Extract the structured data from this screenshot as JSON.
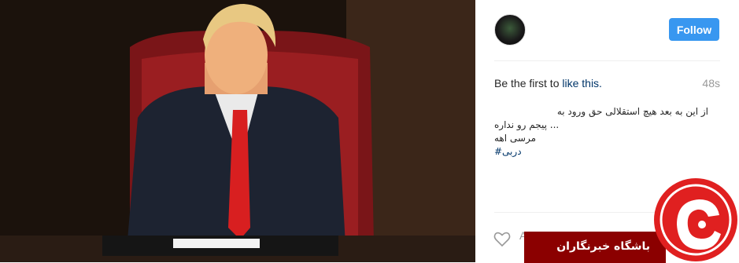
{
  "post": {
    "follow_label": "Follow",
    "likes_prefix": "Be the first to ",
    "likes_link": "like this.",
    "time_ago": "48s",
    "caption_lines": [
      "از این به بعد هیچ استقلالی حق ورود به",
      "... پیجم رو نداره",
      "مرسی اهه"
    ],
    "hashtag": "دربی#",
    "comment_placeholder": "A"
  },
  "watermark": {
    "banner_text": "باشگاه خبرنگاران"
  },
  "colors": {
    "follow_button": "#3897f0",
    "link": "#003569",
    "banner": "#8b0000",
    "logo": "#e02020"
  },
  "icons": [
    "heart-icon",
    "avatar"
  ]
}
